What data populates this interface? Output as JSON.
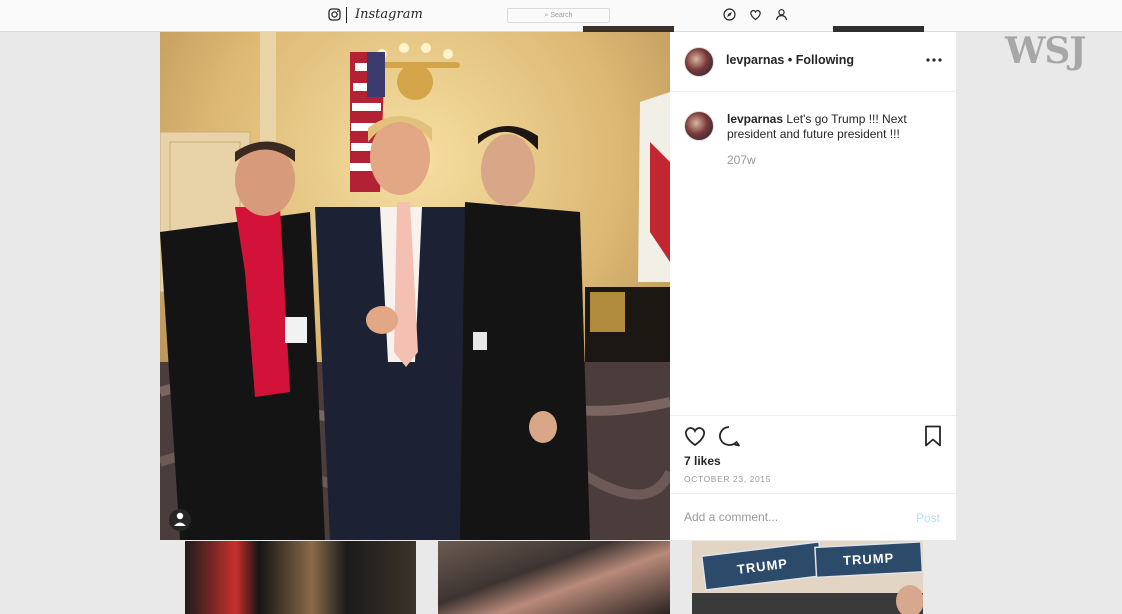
{
  "topbar": {
    "brand": "Instagram",
    "search_placeholder": "Search",
    "icons": [
      "instagram-glyph-icon",
      "compass-icon",
      "heart-icon",
      "profile-icon"
    ]
  },
  "watermark": "WSJ",
  "post": {
    "header": {
      "username": "levparnas",
      "separator": "•",
      "follow_state": "Following"
    },
    "caption": {
      "username": "levparnas",
      "text": "Let's go Trump !!! Next president and future president !!!",
      "age": "207w"
    },
    "likes": "7 likes",
    "date": "OCTOBER 23, 2015",
    "comment_placeholder": "Add a comment...",
    "post_label": "Post"
  },
  "thumbnails": {
    "card_text_1": "TRUMP",
    "card_text_2": "TRUMP"
  },
  "colors": {
    "text": "#262626",
    "muted": "#999999",
    "post_disabled": "#b2dffc",
    "watermark": "#9c9c9c"
  }
}
